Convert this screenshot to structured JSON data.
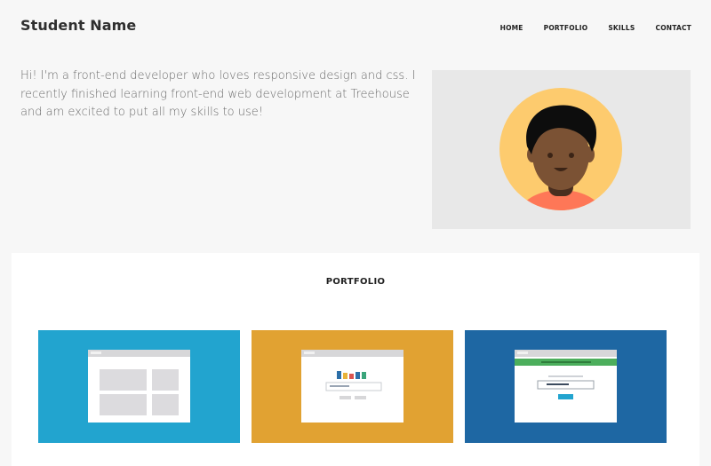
{
  "header": {
    "brand": "Student Name",
    "nav": [
      "HOME",
      "PORTFOLIO",
      "SKILLS",
      "CONTACT"
    ]
  },
  "intro": {
    "text": "Hi! I'm a front-end developer who loves responsive design and css. I recently finished learning front-end web development at Treehouse and am excited to put all my skills to use!"
  },
  "portfolio": {
    "title": "PORTFOLIO",
    "cards": [
      {
        "icon": "browser-grid-layout-icon",
        "bg": "#22a4cf"
      },
      {
        "icon": "browser-bar-chart-icon",
        "bg": "#e1a232"
      },
      {
        "icon": "browser-form-icon",
        "bg": "#1e67a3"
      }
    ]
  },
  "colors": {
    "page_bg": "#f7f7f7",
    "avatar_bg": "#e8e8e8",
    "avatar_circle": "#fdcb6e",
    "shirt": "#fe7757"
  }
}
